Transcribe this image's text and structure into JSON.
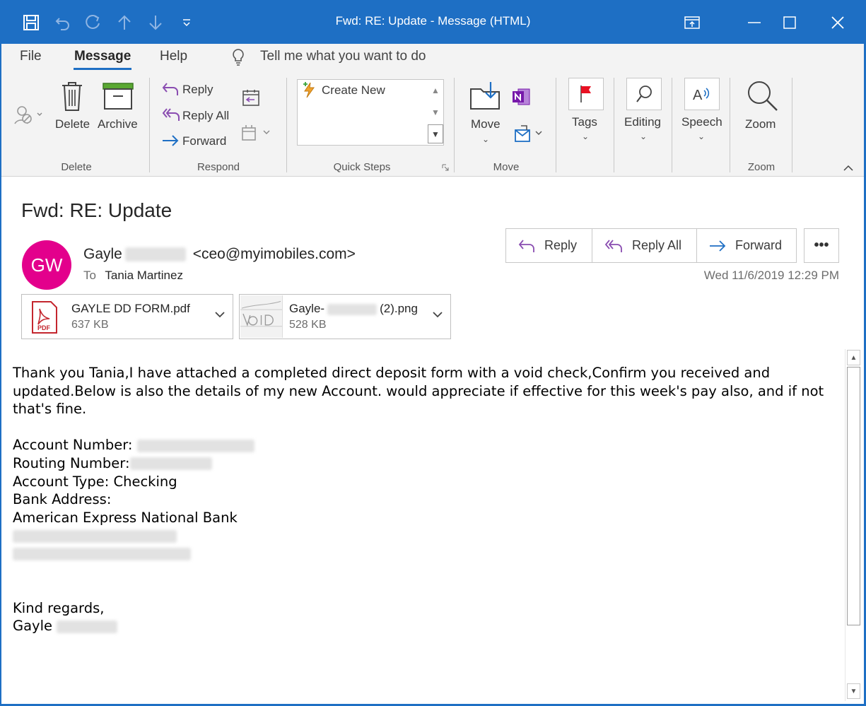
{
  "window": {
    "title": "Fwd: RE: Update  -  Message (HTML)",
    "accent": "#1e6fc4"
  },
  "ribbon": {
    "tabs": [
      "File",
      "Message",
      "Help"
    ],
    "tell_me": "Tell me what you want to do",
    "delete": {
      "delete_label": "Delete",
      "archive_label": "Archive",
      "group": "Delete"
    },
    "respond": {
      "reply": "Reply",
      "reply_all": "Reply All",
      "forward": "Forward",
      "group": "Respond"
    },
    "quick_steps": {
      "create_new": "Create New",
      "group": "Quick Steps"
    },
    "move": {
      "move_label": "Move",
      "group": "Move"
    },
    "tags": {
      "label": "Tags"
    },
    "editing": {
      "label": "Editing"
    },
    "speech": {
      "label": "Speech"
    },
    "zoom": {
      "label": "Zoom",
      "group": "Zoom"
    }
  },
  "message": {
    "subject": "Fwd: RE: Update",
    "avatar_initials": "GW",
    "avatar_color": "#e3008c",
    "sender_first": "Gayle",
    "sender_email": "<ceo@myimobiles.com>",
    "to_label": "To",
    "to_name": "Tania Martinez",
    "date": "Wed 11/6/2019 12:29 PM",
    "actions": {
      "reply": "Reply",
      "reply_all": "Reply All",
      "forward": "Forward",
      "more": "•••"
    },
    "attachments": [
      {
        "name": "GAYLE DD FORM.pdf",
        "size": "637 KB"
      },
      {
        "name_prefix": "Gayle-",
        "name_suffix": "(2).png",
        "size": "528 KB"
      }
    ],
    "body": {
      "line1": "Thank you Tania,I have attached a completed direct deposit form with a void check,Confirm you received and updated.Below is also the details of my new Account. would appreciate if effective for this week's pay also, and if not that's fine.",
      "account_number_label": "Account Number:",
      "routing_number_label": "Routing Number:",
      "account_type": "Account Type: Checking",
      "bank_address_label": "Bank Address:",
      "bank_name": "American Express National Bank",
      "regards": "Kind regards,",
      "signature_first": "Gayle"
    }
  }
}
